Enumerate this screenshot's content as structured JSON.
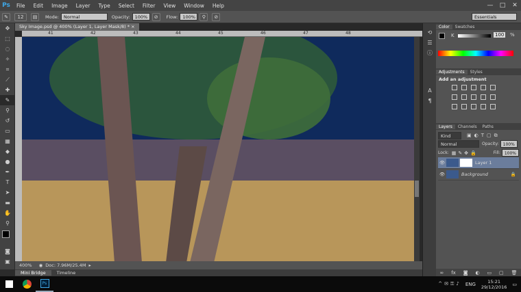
{
  "app": {
    "logo": "Ps"
  },
  "menu": [
    "File",
    "Edit",
    "Image",
    "Layer",
    "Type",
    "Select",
    "Filter",
    "View",
    "Window",
    "Help"
  ],
  "window_controls": {
    "minimize": "—",
    "maximize": "□",
    "close": "✕"
  },
  "options": {
    "brush_size": "12",
    "mode_label": "Mode:",
    "mode_value": "Normal",
    "opacity_label": "Opacity:",
    "opacity_value": "100%",
    "flow_label": "Flow:",
    "flow_value": "100%",
    "workspace": "Essentials"
  },
  "document": {
    "tab_title": "Sky Image.psd @ 400% (Layer 1, Layer Mask/8) *",
    "ruler_h": [
      "41",
      "42",
      "43",
      "44",
      "45",
      "46",
      "47",
      "48"
    ],
    "zoom": "400%",
    "doc_size": "Doc: 7.96M/25.4M"
  },
  "bottom_tabs": [
    "Mini Bridge",
    "Timeline"
  ],
  "color_panel": {
    "tabs": [
      "Color",
      "Swatches"
    ],
    "channel": "K",
    "value": "100",
    "unit": "%"
  },
  "adjustments_panel": {
    "tabs": [
      "Adjustments",
      "Styles"
    ],
    "heading": "Add an adjustment"
  },
  "layers_panel": {
    "tabs": [
      "Layers",
      "Channels",
      "Paths"
    ],
    "filter": "Kind",
    "blend": "Normal",
    "opacity_label": "Opacity:",
    "opacity_value": "100%",
    "lock_label": "Lock:",
    "fill_label": "Fill:",
    "fill_value": "100%",
    "layers": [
      {
        "name": "Layer 1"
      },
      {
        "name": "Background"
      }
    ]
  },
  "taskbar": {
    "lang": "ENG",
    "time": "15:21",
    "date": "29/12/2016"
  },
  "colors": {
    "accent": "#3fa7e6",
    "sky": "#0f2a5c",
    "field": "#b8965a"
  }
}
